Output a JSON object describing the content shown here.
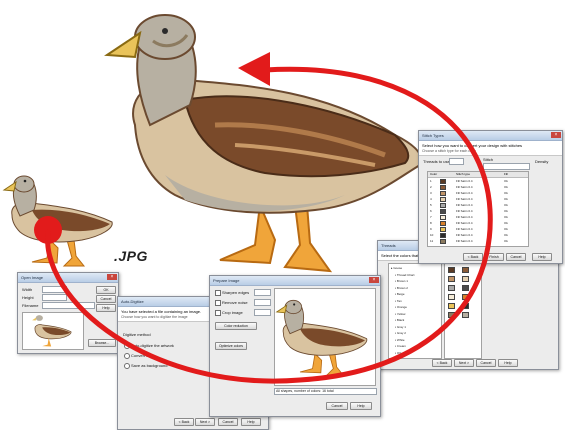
{
  "caption_label": ".JPG",
  "windows": {
    "open_image": {
      "title": "Open Image",
      "fields": [
        "Width",
        "Height",
        "Filename"
      ],
      "buttons": [
        "OK",
        "Cancel",
        "Help",
        "Browse..."
      ]
    },
    "wizard": {
      "title": "Auto-Digitize",
      "heading": "You have selected a file containing an image.",
      "subheading": "Choose how you want to digitize the image",
      "option_label": "Digitize method",
      "options": [
        "Auto-digitize the artwork",
        "Convert only",
        "Save as background"
      ],
      "buttons": [
        "< Back",
        "Next >",
        "Cancel",
        "Help"
      ]
    },
    "prepare": {
      "title": "Prepare Image",
      "options": [
        "Sharpen edges",
        "Remove noise",
        "Crop image"
      ],
      "buttons": [
        "Color reduction",
        "Optimize colors",
        "Cancel",
        "Help"
      ],
      "status": "All shapes, number of colors: 16 total"
    },
    "threads": {
      "title": "Threads",
      "heading": "Select the colors that you want to use",
      "items": [
        "Goose",
        "Thread Chart",
        "Brown 1",
        "Brown 2",
        "Beige",
        "Tan",
        "Orange",
        "Yellow",
        "Black",
        "Gray 1",
        "Gray 2",
        "White",
        "Cream",
        "Olive"
      ],
      "buttons": [
        "< Back",
        "Next >",
        "Cancel",
        "Help"
      ]
    },
    "stitch": {
      "title": "Stitch Types",
      "heading": "Select how you want to convert your design with stitches",
      "subheading": "Choose a stitch type for each color",
      "labels": [
        "Threads to use",
        "Stitch",
        "Fill",
        "Density"
      ],
      "columns": [
        "Color",
        "Stitch type",
        "Fill"
      ],
      "rows": [
        [
          "1",
          "Fill Satin 0.4",
          "Ok"
        ],
        [
          "2",
          "Fill Satin 0.4",
          "Ok"
        ],
        [
          "3",
          "Fill Satin 0.4",
          "Ok"
        ],
        [
          "4",
          "Fill Satin 0.4",
          "Ok"
        ],
        [
          "5",
          "Fill Satin 0.4",
          "Ok"
        ],
        [
          "6",
          "Fill Satin 0.4",
          "Ok"
        ],
        [
          "7",
          "Fill Satin 0.4",
          "Ok"
        ],
        [
          "8",
          "Fill Satin 0.4",
          "Ok"
        ],
        [
          "9",
          "Fill Satin 0.4",
          "Ok"
        ],
        [
          "10",
          "Fill Satin 0.4",
          "Ok"
        ],
        [
          "11",
          "Fill Satin 0.4",
          "Ok"
        ]
      ],
      "buttons": [
        "< Back",
        "Finish",
        "Cancel",
        "Help"
      ]
    }
  },
  "colors": {
    "arrow": "#e21b1b",
    "goose_brown": "#7a4a2a",
    "goose_beige": "#d9c3a0",
    "goose_gray": "#b7b0a2",
    "goose_orange": "#f0a53a"
  },
  "swatches": [
    "#5a3a24",
    "#8a5a36",
    "#c09468",
    "#e6d2b2",
    "#a9a9a9",
    "#4a4a4a",
    "#f5ecd8",
    "#d87f2a",
    "#e9c35a",
    "#2b2b2b",
    "#8c7b60",
    "#b7b0a2"
  ]
}
